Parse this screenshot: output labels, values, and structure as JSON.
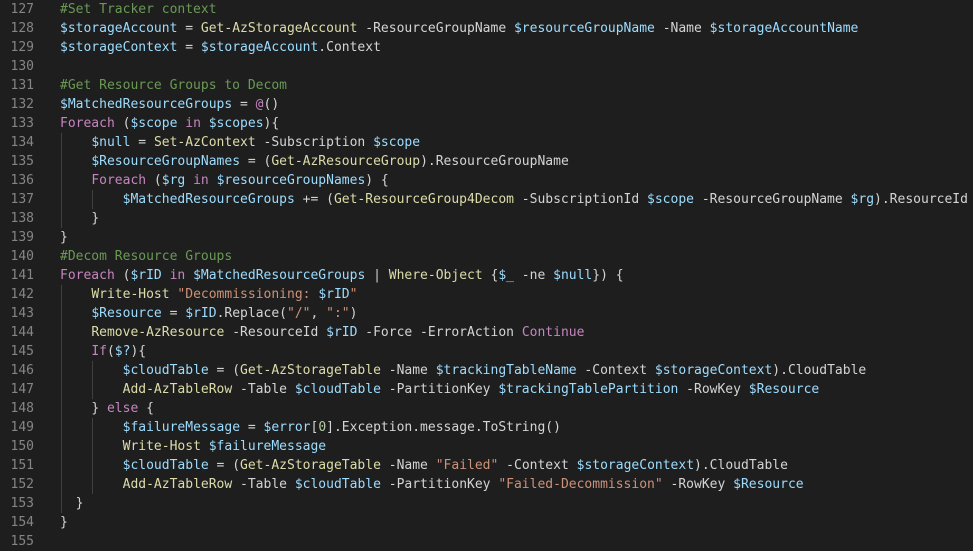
{
  "theme": {
    "background": "#1e1e1e",
    "line_number": "#858585",
    "comment": "#6a9955",
    "variable": "#9cdcfe",
    "command": "#dcdcaa",
    "keyword": "#c586c0",
    "string": "#ce9178",
    "number": "#b5cea8",
    "default": "#d4d4d4"
  },
  "lines": [
    {
      "n": "127",
      "indent": 0,
      "tokens": [
        [
          "comment",
          "#Set Tracker context"
        ]
      ]
    },
    {
      "n": "128",
      "indent": 0,
      "tokens": [
        [
          "var",
          "$storageAccount"
        ],
        [
          "op",
          " = "
        ],
        [
          "cmd",
          "Get-AzStorageAccount"
        ],
        [
          "param",
          " -ResourceGroupName "
        ],
        [
          "var",
          "$resourceGroupName"
        ],
        [
          "param",
          " -Name "
        ],
        [
          "var",
          "$storageAccountName"
        ]
      ]
    },
    {
      "n": "129",
      "indent": 0,
      "tokens": [
        [
          "var",
          "$storageContext"
        ],
        [
          "op",
          " = "
        ],
        [
          "var",
          "$storageAccount"
        ],
        [
          "default",
          ".Context"
        ]
      ]
    },
    {
      "n": "130",
      "indent": 0,
      "tokens": []
    },
    {
      "n": "131",
      "indent": 0,
      "tokens": [
        [
          "comment",
          "#Get Resource Groups to Decom"
        ]
      ]
    },
    {
      "n": "132",
      "indent": 0,
      "tokens": [
        [
          "var",
          "$MatchedResourceGroups"
        ],
        [
          "op",
          " = "
        ],
        [
          "kw",
          "@"
        ],
        [
          "default",
          "()"
        ]
      ]
    },
    {
      "n": "133",
      "indent": 0,
      "tokens": [
        [
          "kw",
          "Foreach"
        ],
        [
          "default",
          " ("
        ],
        [
          "var",
          "$scope"
        ],
        [
          "kw",
          " in "
        ],
        [
          "var",
          "$scopes"
        ],
        [
          "default",
          "){"
        ]
      ]
    },
    {
      "n": "134",
      "indent": 1,
      "tokens": [
        [
          "var",
          "$null"
        ],
        [
          "op",
          " = "
        ],
        [
          "cmd",
          "Set-AzContext"
        ],
        [
          "param",
          " -Subscription "
        ],
        [
          "var",
          "$scope"
        ]
      ]
    },
    {
      "n": "135",
      "indent": 1,
      "tokens": [
        [
          "var",
          "$ResourceGroupNames"
        ],
        [
          "op",
          " = "
        ],
        [
          "default",
          "("
        ],
        [
          "cmd",
          "Get-AzResourceGroup"
        ],
        [
          "default",
          ").ResourceGroupName"
        ]
      ]
    },
    {
      "n": "136",
      "indent": 1,
      "tokens": [
        [
          "kw",
          "Foreach"
        ],
        [
          "default",
          " ("
        ],
        [
          "var",
          "$rg"
        ],
        [
          "kw",
          " in "
        ],
        [
          "var",
          "$resourceGroupNames"
        ],
        [
          "default",
          ") {"
        ]
      ]
    },
    {
      "n": "137",
      "indent": 2,
      "tokens": [
        [
          "var",
          "$MatchedResourceGroups"
        ],
        [
          "op",
          " += "
        ],
        [
          "default",
          "("
        ],
        [
          "cmd",
          "Get-ResourceGroup4Decom"
        ],
        [
          "param",
          " -SubscriptionId "
        ],
        [
          "var",
          "$scope"
        ],
        [
          "param",
          " -ResourceGroupName "
        ],
        [
          "var",
          "$rg"
        ],
        [
          "default",
          ").ResourceId"
        ]
      ]
    },
    {
      "n": "138",
      "indent": 1,
      "tokens": [
        [
          "default",
          "}"
        ]
      ]
    },
    {
      "n": "139",
      "indent": 0,
      "tokens": [
        [
          "default",
          "}"
        ]
      ]
    },
    {
      "n": "140",
      "indent": 0,
      "tokens": [
        [
          "comment",
          "#Decom Resource Groups"
        ]
      ]
    },
    {
      "n": "141",
      "indent": 0,
      "tokens": [
        [
          "kw",
          "Foreach"
        ],
        [
          "default",
          " ("
        ],
        [
          "var",
          "$rID"
        ],
        [
          "kw",
          " in "
        ],
        [
          "var",
          "$MatchedResourceGroups"
        ],
        [
          "op",
          " | "
        ],
        [
          "cmd",
          "Where-Object"
        ],
        [
          "default",
          " {"
        ],
        [
          "var",
          "$_"
        ],
        [
          "param",
          " -ne "
        ],
        [
          "var",
          "$null"
        ],
        [
          "default",
          "}) {"
        ]
      ]
    },
    {
      "n": "142",
      "indent": 1,
      "tokens": [
        [
          "cmd",
          "Write-Host"
        ],
        [
          "default",
          " "
        ],
        [
          "str",
          "\"Decommissioning: "
        ],
        [
          "var",
          "$rID"
        ],
        [
          "str",
          "\""
        ]
      ]
    },
    {
      "n": "143",
      "indent": 1,
      "tokens": [
        [
          "var",
          "$Resource"
        ],
        [
          "op",
          " = "
        ],
        [
          "var",
          "$rID"
        ],
        [
          "default",
          ".Replace("
        ],
        [
          "str",
          "\"/\""
        ],
        [
          "default",
          ", "
        ],
        [
          "str",
          "\":\""
        ],
        [
          "default",
          ")"
        ]
      ]
    },
    {
      "n": "144",
      "indent": 1,
      "tokens": [
        [
          "cmd",
          "Remove-AzResource"
        ],
        [
          "param",
          " -ResourceId "
        ],
        [
          "var",
          "$rID"
        ],
        [
          "param",
          " -Force -ErrorAction "
        ],
        [
          "kw",
          "Continue"
        ]
      ]
    },
    {
      "n": "145",
      "indent": 1,
      "tokens": [
        [
          "kw",
          "If"
        ],
        [
          "default",
          "("
        ],
        [
          "var",
          "$?"
        ],
        [
          "default",
          "){"
        ]
      ]
    },
    {
      "n": "146",
      "indent": 2,
      "tokens": [
        [
          "var",
          "$cloudTable"
        ],
        [
          "op",
          " = "
        ],
        [
          "default",
          "("
        ],
        [
          "cmd",
          "Get-AzStorageTable"
        ],
        [
          "param",
          " -Name "
        ],
        [
          "var",
          "$trackingTableName"
        ],
        [
          "param",
          " -Context "
        ],
        [
          "var",
          "$storageContext"
        ],
        [
          "default",
          ").CloudTable"
        ]
      ]
    },
    {
      "n": "147",
      "indent": 2,
      "tokens": [
        [
          "cmd",
          "Add-AzTableRow"
        ],
        [
          "param",
          " -Table "
        ],
        [
          "var",
          "$cloudTable"
        ],
        [
          "param",
          " -PartitionKey "
        ],
        [
          "var",
          "$trackingTablePartition"
        ],
        [
          "param",
          " -RowKey "
        ],
        [
          "var",
          "$Resource"
        ]
      ]
    },
    {
      "n": "148",
      "indent": 1,
      "tokens": [
        [
          "default",
          "} "
        ],
        [
          "kw",
          "else"
        ],
        [
          "default",
          " {"
        ]
      ]
    },
    {
      "n": "149",
      "indent": 2,
      "tokens": [
        [
          "var",
          "$failureMessage"
        ],
        [
          "op",
          " = "
        ],
        [
          "var",
          "$error"
        ],
        [
          "default",
          "["
        ],
        [
          "num",
          "0"
        ],
        [
          "default",
          "].Exception.message.ToString()"
        ]
      ]
    },
    {
      "n": "150",
      "indent": 2,
      "tokens": [
        [
          "cmd",
          "Write-Host"
        ],
        [
          "default",
          " "
        ],
        [
          "var",
          "$failureMessage"
        ]
      ]
    },
    {
      "n": "151",
      "indent": 2,
      "tokens": [
        [
          "var",
          "$cloudTable"
        ],
        [
          "op",
          " = "
        ],
        [
          "default",
          "("
        ],
        [
          "cmd",
          "Get-AzStorageTable"
        ],
        [
          "param",
          " -Name "
        ],
        [
          "str",
          "\"Failed\""
        ],
        [
          "param",
          " -Context "
        ],
        [
          "var",
          "$storageContext"
        ],
        [
          "default",
          ").CloudTable"
        ]
      ]
    },
    {
      "n": "152",
      "indent": 2,
      "tokens": [
        [
          "cmd",
          "Add-AzTableRow"
        ],
        [
          "param",
          " -Table "
        ],
        [
          "var",
          "$cloudTable"
        ],
        [
          "param",
          " -PartitionKey "
        ],
        [
          "str",
          "\"Failed-Decommission\""
        ],
        [
          "param",
          " -RowKey "
        ],
        [
          "var",
          "$Resource"
        ]
      ]
    },
    {
      "n": "153",
      "indent": 1,
      "indentText": "  ",
      "tokens": [
        [
          "default",
          "}"
        ]
      ]
    },
    {
      "n": "154",
      "indent": 0,
      "tokens": [
        [
          "default",
          "}"
        ]
      ]
    },
    {
      "n": "155",
      "indent": 0,
      "tokens": []
    }
  ]
}
